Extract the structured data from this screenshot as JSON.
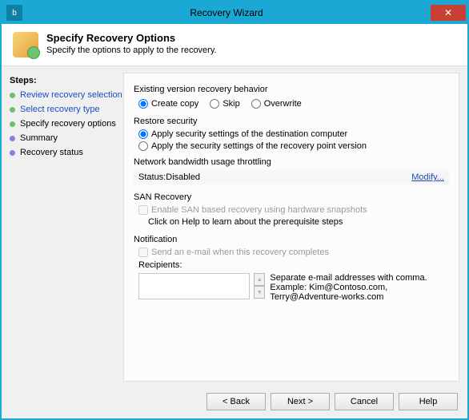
{
  "titlebar": {
    "title": "Recovery Wizard"
  },
  "header": {
    "title": "Specify Recovery Options",
    "subtitle": "Specify the options to apply to the recovery."
  },
  "steps": {
    "title": "Steps:",
    "items": [
      {
        "label": "Review recovery selection",
        "state": "done-link"
      },
      {
        "label": "Select recovery type",
        "state": "done-link"
      },
      {
        "label": "Specify recovery options",
        "state": "current"
      },
      {
        "label": "Summary",
        "state": "pending"
      },
      {
        "label": "Recovery status",
        "state": "pending"
      }
    ]
  },
  "main": {
    "existing_version": {
      "label": "Existing version recovery behavior",
      "options": {
        "create_copy": "Create copy",
        "skip": "Skip",
        "overwrite": "Overwrite"
      },
      "selected": "create_copy"
    },
    "restore_security": {
      "label": "Restore security",
      "opt_dest": "Apply security settings of the destination computer",
      "opt_rp": "Apply the security settings of the recovery point version",
      "selected": "dest"
    },
    "throttling": {
      "label": "Network bandwidth usage throttling",
      "status_prefix": "Status: ",
      "status_value": "Disabled",
      "modify": "Modify..."
    },
    "san": {
      "label": "SAN Recovery",
      "checkbox": "Enable SAN based recovery using hardware snapshots",
      "help": "Click on Help to learn about the prerequisite steps"
    },
    "notification": {
      "label": "Notification",
      "checkbox": "Send an e-mail when this recovery completes",
      "recipients_label": "Recipients:",
      "hint1": "Separate e-mail addresses with comma.",
      "hint2": "Example: Kim@Contoso.com, Terry@Adventure-works.com"
    }
  },
  "footer": {
    "back": "< Back",
    "next": "Next >",
    "cancel": "Cancel",
    "help": "Help"
  }
}
